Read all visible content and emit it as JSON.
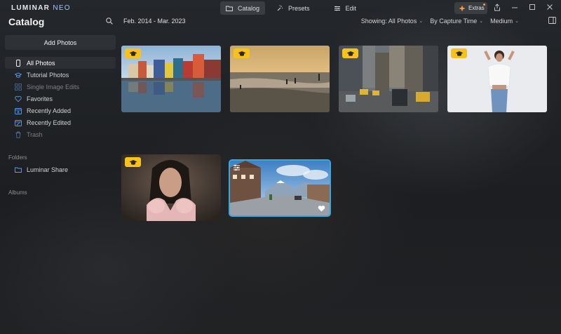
{
  "app": {
    "logo_main": "LUMINAR",
    "logo_sub": "NEO"
  },
  "modes": [
    {
      "label": "Catalog",
      "icon": "folder-icon",
      "active": true
    },
    {
      "label": "Presets",
      "icon": "sparkle-wand-icon",
      "active": false
    },
    {
      "label": "Edit",
      "icon": "sliders-icon",
      "active": false
    }
  ],
  "extras": {
    "label": "Extras",
    "icon": "extras-star-icon"
  },
  "header": {
    "title": "Catalog",
    "date_range": "Feb. 2014 - Mar. 2023",
    "showing": "Showing: All Photos",
    "sort": "By Capture Time",
    "size": "Medium"
  },
  "sidebar": {
    "add_photos": "Add Photos",
    "items": [
      {
        "label": "All Photos",
        "icon": "phone-icon",
        "active": true,
        "dim": false
      },
      {
        "label": "Tutorial Photos",
        "icon": "graduation-cap-icon",
        "active": false,
        "dim": false
      },
      {
        "label": "Single Image Edits",
        "icon": "grid-icon",
        "active": false,
        "dim": true
      },
      {
        "label": "Favorites",
        "icon": "heart-icon",
        "active": false,
        "dim": false
      },
      {
        "label": "Recently Added",
        "icon": "calendar-add-icon",
        "active": false,
        "dim": false
      },
      {
        "label": "Recently Edited",
        "icon": "calendar-edit-icon",
        "active": false,
        "dim": false
      },
      {
        "label": "Trash",
        "icon": "trash-icon",
        "active": false,
        "dim": true
      }
    ],
    "folders_label": "Folders",
    "folders": [
      {
        "label": "Luminar Share",
        "icon": "folder-icon"
      }
    ],
    "albums_label": "Albums"
  },
  "photos": [
    {
      "subject": "harbor-houses",
      "tutorial": true,
      "selected": false,
      "favorite": false
    },
    {
      "subject": "beach-sunset",
      "tutorial": true,
      "selected": false,
      "favorite": false
    },
    {
      "subject": "city-street",
      "tutorial": true,
      "selected": false,
      "favorite": false
    },
    {
      "subject": "woman-white",
      "tutorial": true,
      "selected": false,
      "favorite": false
    },
    {
      "subject": "portrait-woman",
      "tutorial": true,
      "selected": false,
      "favorite": false
    },
    {
      "subject": "mountain-town",
      "tutorial": false,
      "selected": true,
      "favorite": true
    }
  ],
  "colors": {
    "accent_blue": "#37a8e0",
    "badge_yellow": "#f7c21a",
    "nav_icon_blue": "#5b9cf0"
  }
}
